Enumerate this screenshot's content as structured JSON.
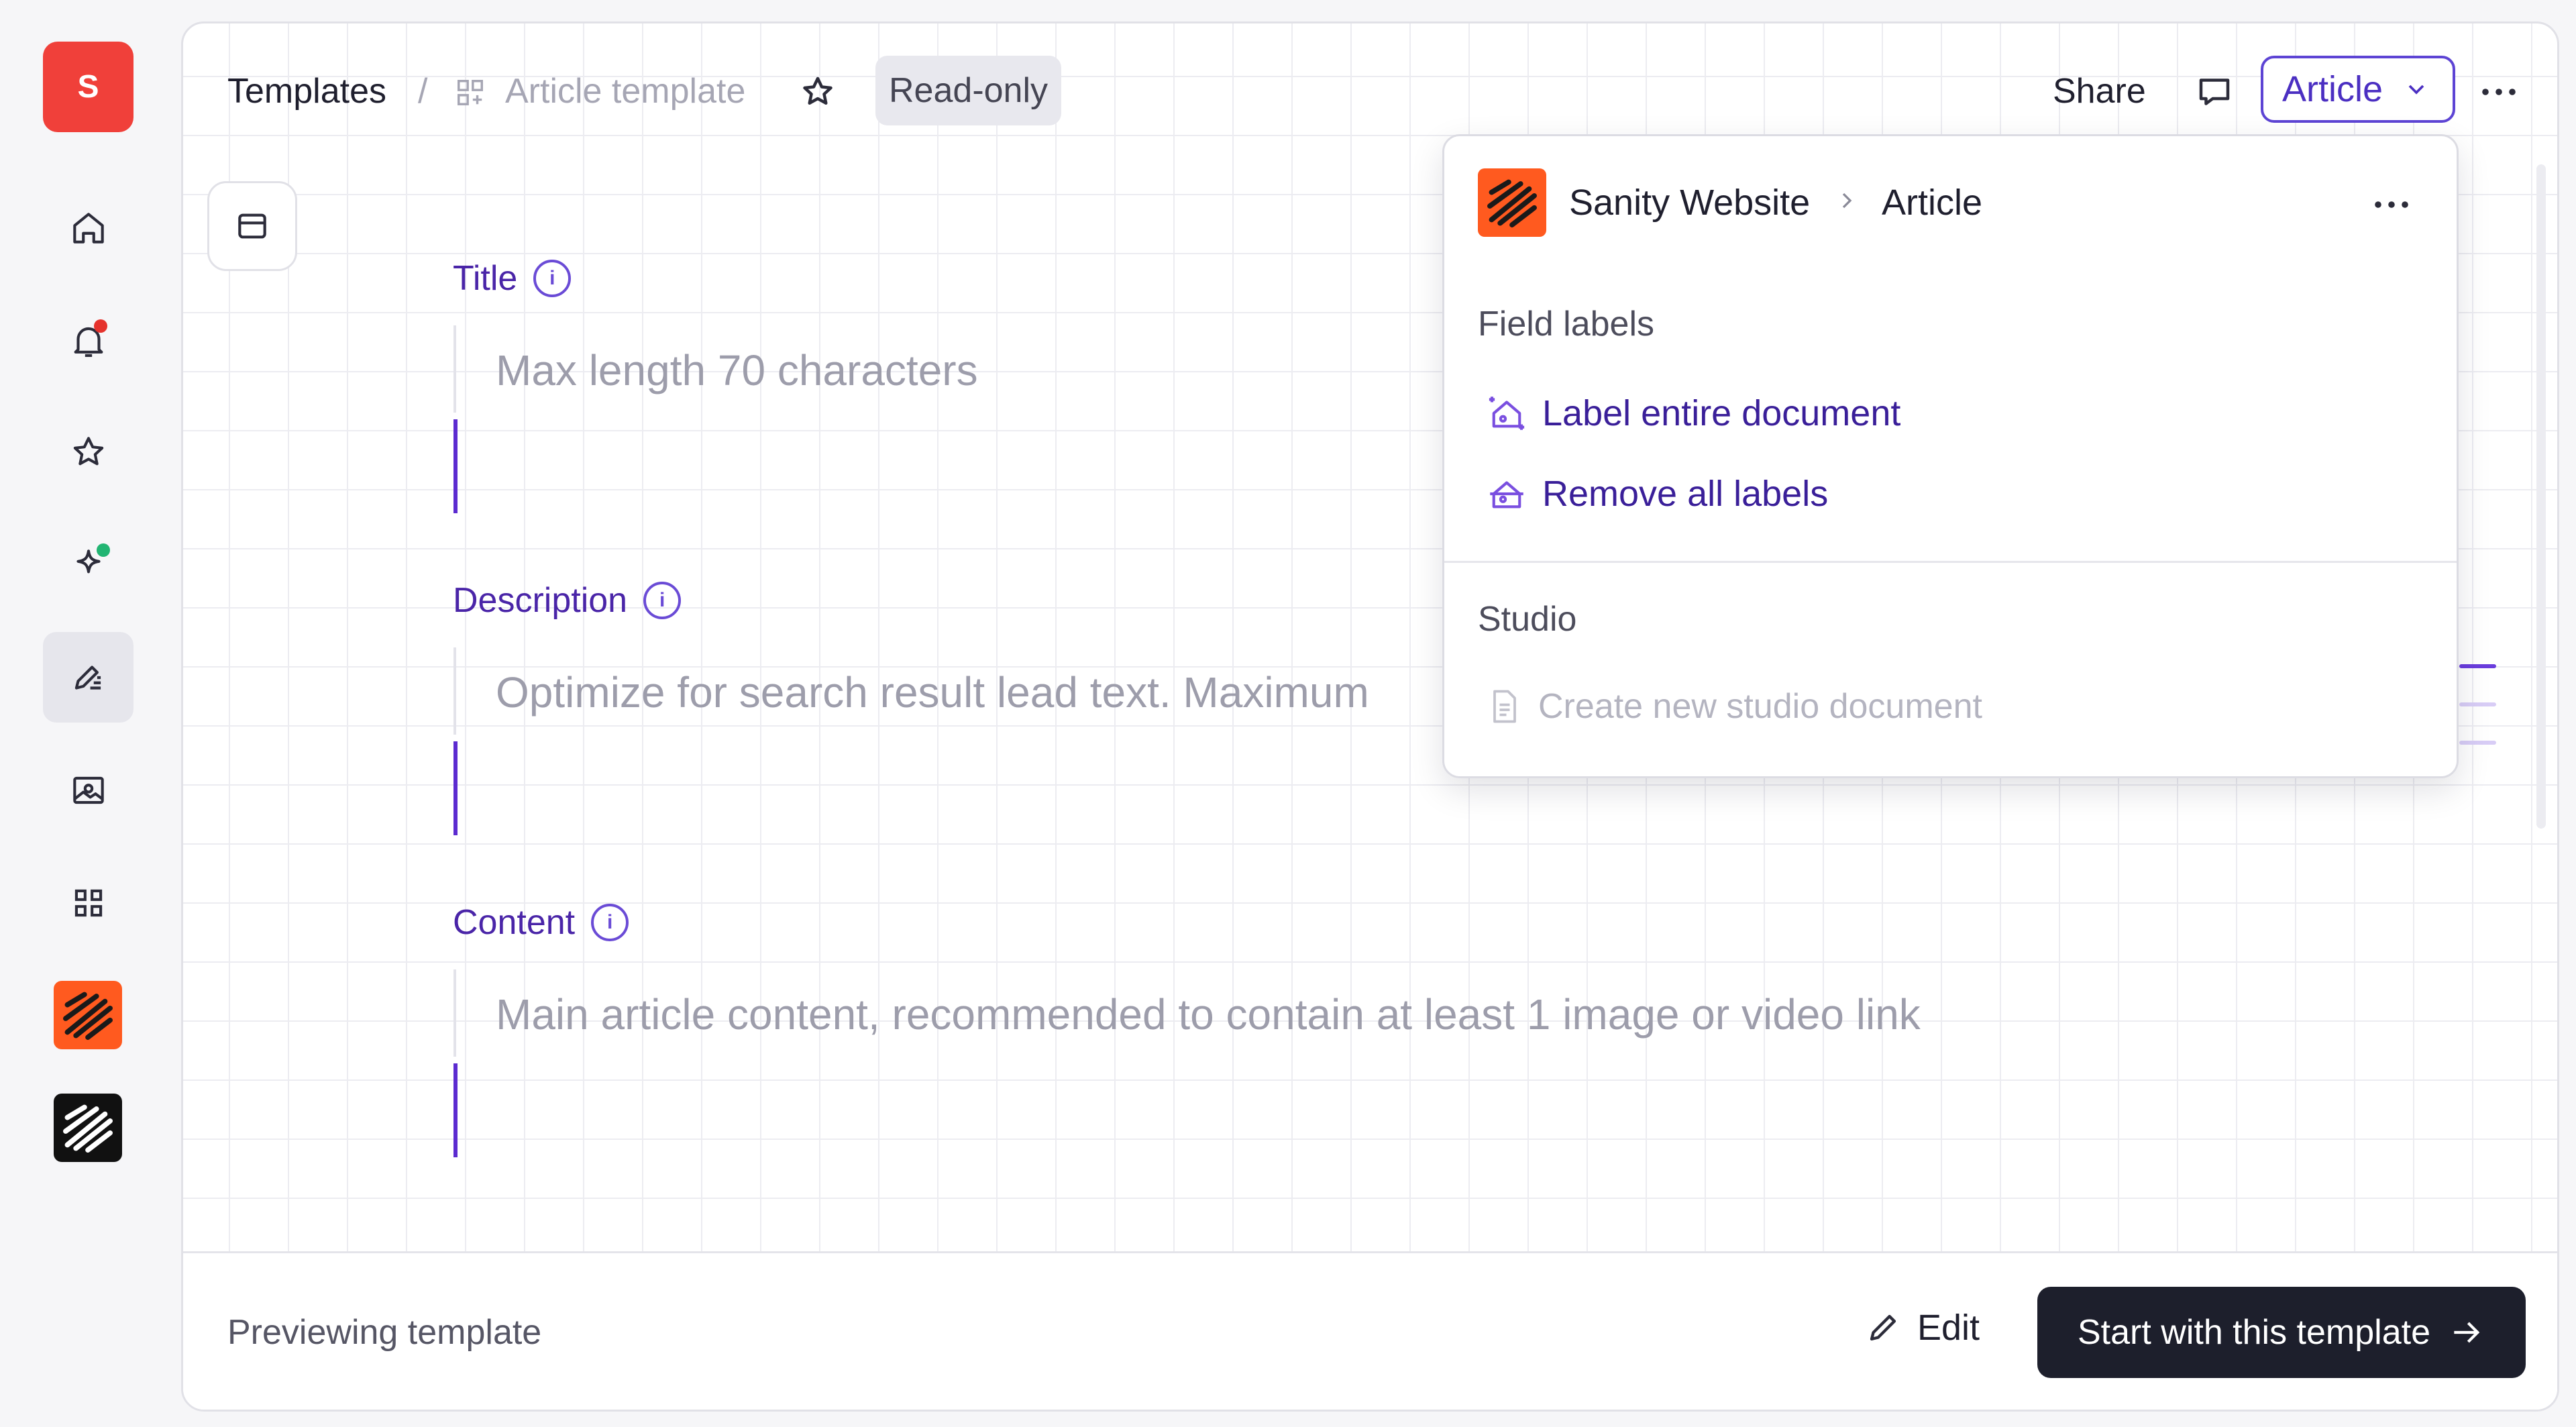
{
  "rail": {
    "org_initial": "S",
    "items": [
      {
        "name": "home-icon"
      },
      {
        "name": "bell-icon"
      },
      {
        "name": "star-icon"
      },
      {
        "name": "sparkle-icon"
      },
      {
        "name": "compose-icon"
      },
      {
        "name": "image-icon"
      },
      {
        "name": "grid-icon"
      }
    ]
  },
  "header": {
    "breadcrumb_root": "Templates",
    "separator": "/",
    "breadcrumb_current": "Article template",
    "readonly_badge": "Read-only",
    "share_label": "Share",
    "type_selector": "Article"
  },
  "fields": [
    {
      "label": "Title",
      "placeholder": "Max length 70 characters"
    },
    {
      "label": "Description",
      "placeholder": "Optimize for search result lead text. Maximum"
    },
    {
      "label": "Content",
      "placeholder": "Main article content, recommended to contain at least 1 image or video link"
    }
  ],
  "footer": {
    "status": "Previewing template",
    "edit_label": "Edit",
    "start_label": "Start with this template"
  },
  "popover": {
    "project": "Sanity Website",
    "doc_type": "Article",
    "section_labels": "Field labels",
    "label_entire": "Label entire document",
    "remove_labels": "Remove all labels",
    "section_studio": "Studio",
    "create_doc": "Create new studio document"
  },
  "colors": {
    "accent": "#5c2bd0",
    "org_avatar": "#f0403a",
    "logo_orange": "#ff5a1f",
    "primary_button": "#1d1f2c"
  }
}
